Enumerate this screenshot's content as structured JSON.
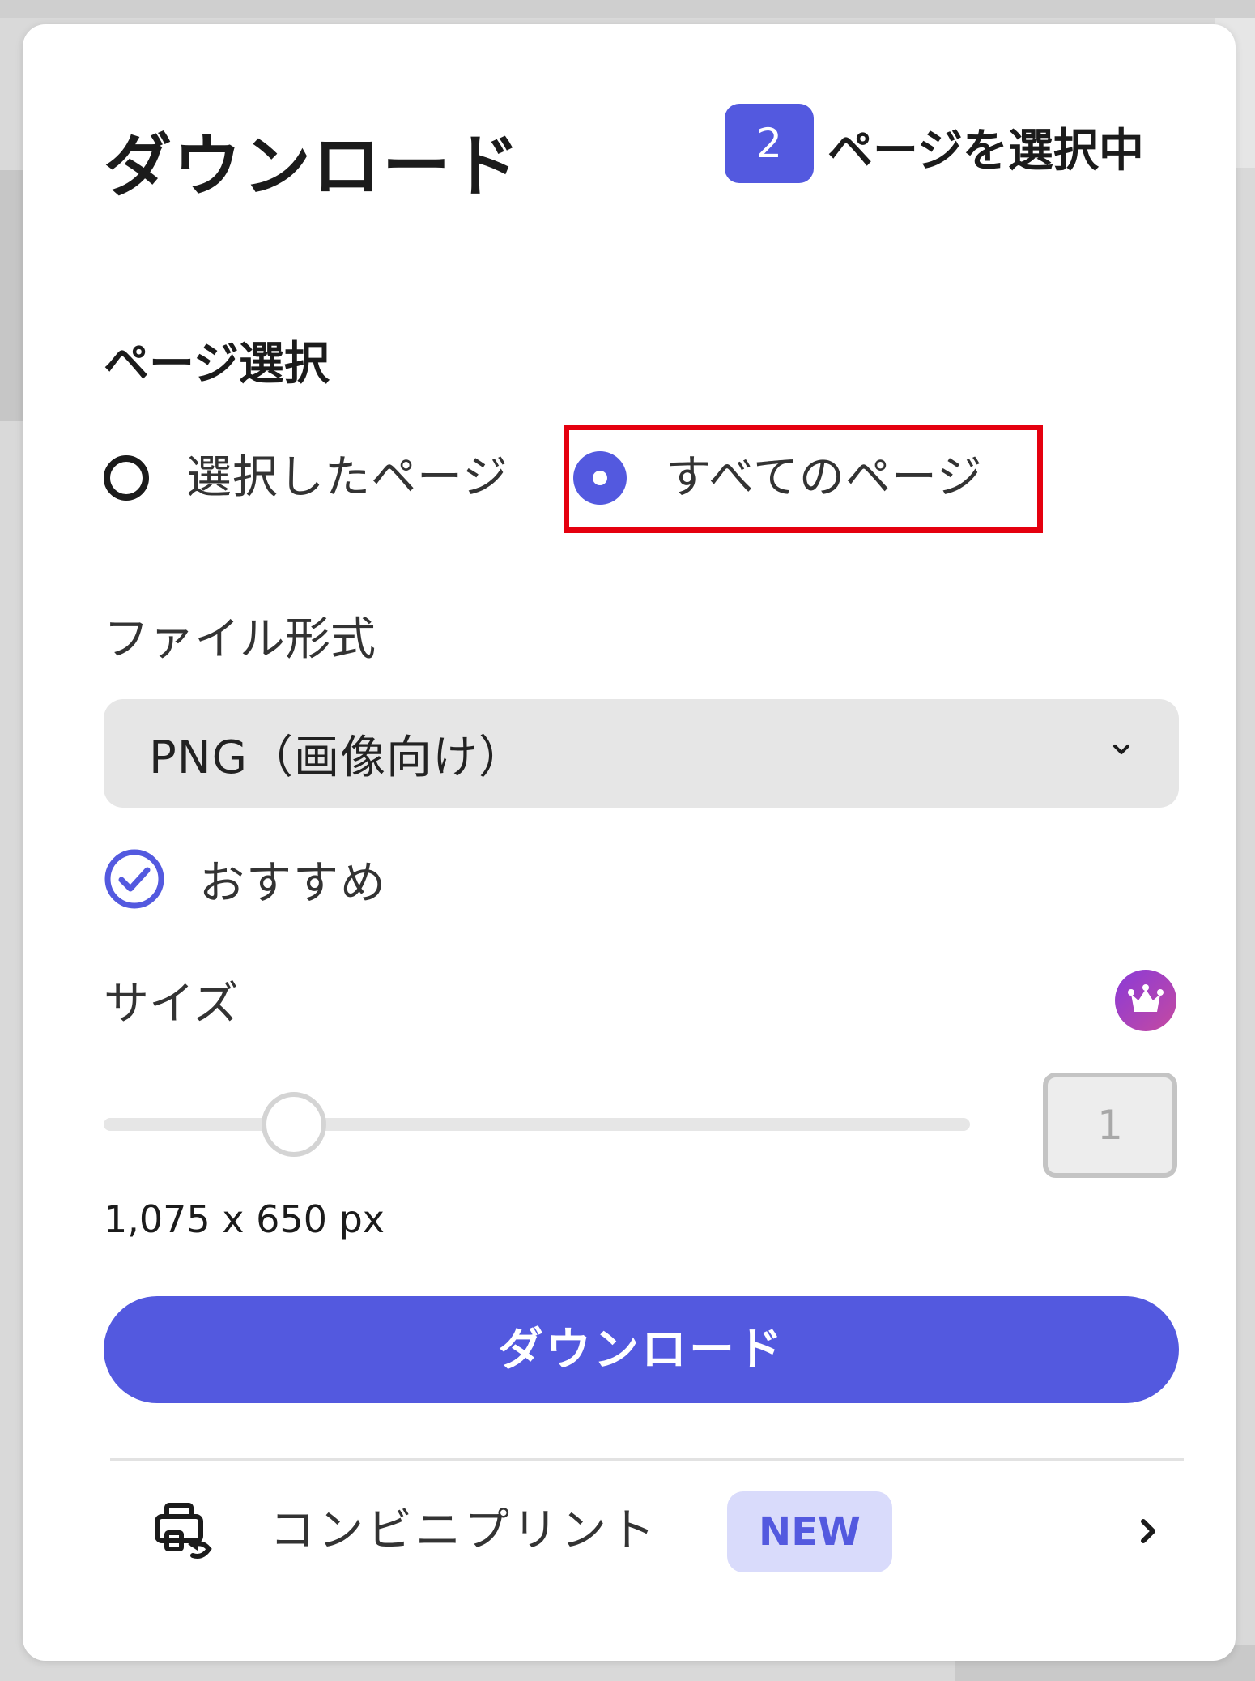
{
  "dialog": {
    "title": "ダウンロード",
    "selected_count": "2",
    "selected_suffix": "ページを選択中"
  },
  "page_selection": {
    "label": "ページ選択",
    "options": [
      {
        "label": "選択したページ",
        "checked": false
      },
      {
        "label": "すべてのページ",
        "checked": true
      }
    ]
  },
  "file_format": {
    "label": "ファイル形式",
    "selected": "PNG（画像向け）",
    "recommended_label": "おすすめ",
    "recommended_checked": true
  },
  "size": {
    "label": "サイズ",
    "slider_value": 1,
    "input_value": "1",
    "dimensions": "1,075 x 650 px",
    "premium_icon": "crown-icon"
  },
  "download_button": {
    "label": "ダウンロード"
  },
  "convenience_print": {
    "label": "コンビニプリント",
    "badge": "NEW",
    "icon": "printer-sync-icon"
  },
  "colors": {
    "accent": "#5359df",
    "highlight": "#e5000f",
    "badge_bg": "#d9dbfb"
  }
}
